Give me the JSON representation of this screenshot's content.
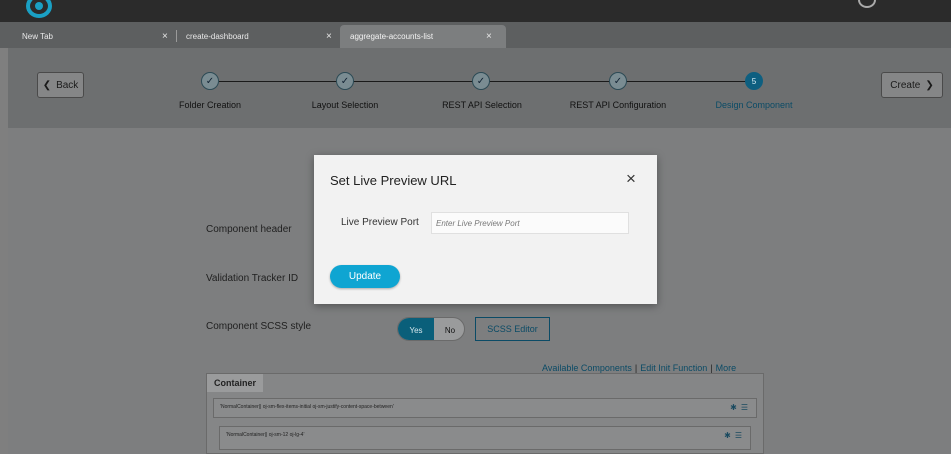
{
  "tabs": [
    {
      "label": "New Tab",
      "close": "×"
    },
    {
      "label": "create-dashboard",
      "close": "×"
    },
    {
      "label": "aggregate-accounts-list",
      "close": "×"
    }
  ],
  "wizard": {
    "back_label": "Back",
    "back_icon": "chevron-left-icon",
    "create_label": "Create",
    "create_icon": "chevron-right-icon",
    "steps": [
      {
        "label": "Folder Creation",
        "status": "done",
        "mark": "✓"
      },
      {
        "label": "Layout Selection",
        "status": "done",
        "mark": "✓"
      },
      {
        "label": "REST API Selection",
        "status": "done",
        "mark": "✓"
      },
      {
        "label": "REST API Configuration",
        "status": "done",
        "mark": "✓"
      },
      {
        "label": "Design Component",
        "status": "current",
        "mark": "5"
      }
    ]
  },
  "form": {
    "component_header_label": "Component header",
    "validation_tracker_label": "Validation Tracker ID",
    "scss_style_label": "Component SCSS style",
    "toggle_yes": "Yes",
    "toggle_no": "No",
    "scss_editor_label": "SCSS Editor",
    "links": [
      "Available Components",
      "Edit Init Function",
      "More"
    ],
    "container_title": "Container",
    "rows": [
      "'NormalContainer|| oj-sm-flex-items-initial oj-sm-justify-content-space-between'",
      "'NormalContainer|| oj-sm-12 oj-lg-4'"
    ]
  },
  "modal": {
    "title": "Set Live Preview URL",
    "close": "×",
    "port_label": "Live Preview Port",
    "port_placeholder": "Enter Live Preview Port",
    "port_value": "",
    "update_label": "Update"
  },
  "colors": {
    "accent": "#0fa5d2",
    "current_step": "#0e5f80"
  }
}
